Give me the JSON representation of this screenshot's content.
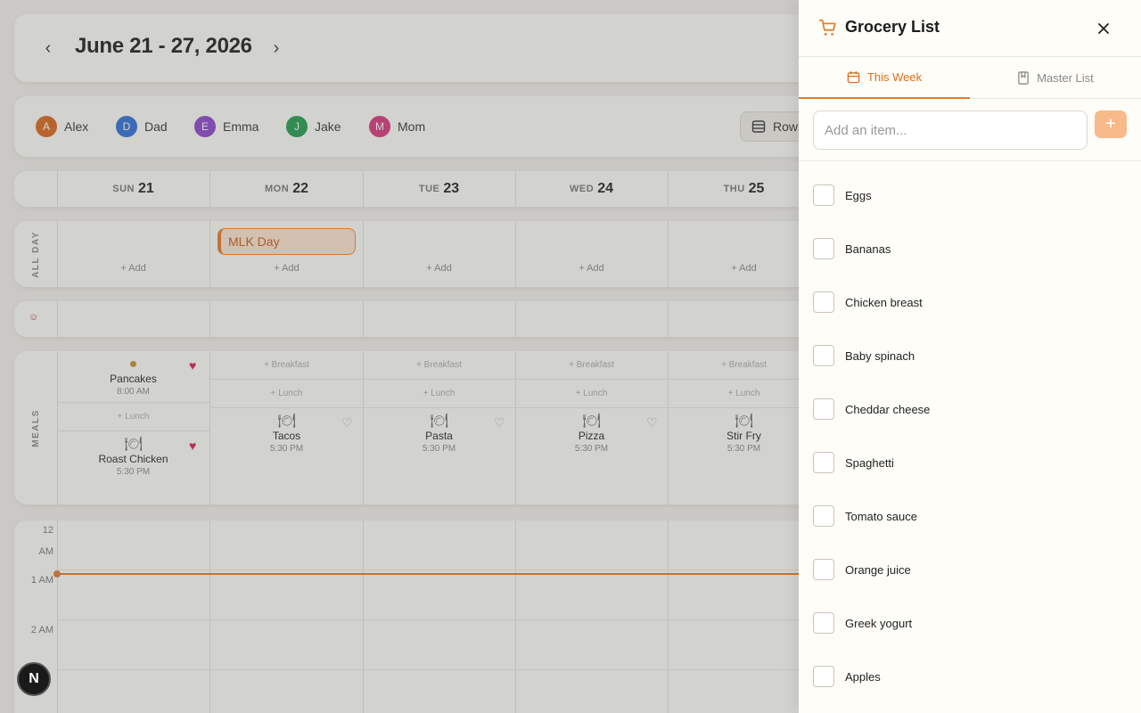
{
  "calendar": {
    "week_title": "June 21 - 27, 2026",
    "members": [
      {
        "initial": "A",
        "name": "Alex",
        "color": "#d9651b"
      },
      {
        "initial": "D",
        "name": "Dad",
        "color": "#2f6fd6"
      },
      {
        "initial": "E",
        "name": "Emma",
        "color": "#8a44c9"
      },
      {
        "initial": "J",
        "name": "Jake",
        "color": "#1f9a4a"
      },
      {
        "initial": "M",
        "name": "Mom",
        "color": "#d6357a"
      }
    ],
    "view_toggle": "Rows",
    "days": [
      {
        "dow": "SUN",
        "num": "21"
      },
      {
        "dow": "MON",
        "num": "22"
      },
      {
        "dow": "TUE",
        "num": "23"
      },
      {
        "dow": "WED",
        "num": "24"
      },
      {
        "dow": "THU",
        "num": "25"
      }
    ],
    "all_day_label": "ALL DAY",
    "add_label": "+ Add",
    "event": "MLK Day",
    "meals_label": "MEALS",
    "breakfast_add": "+ Breakfast",
    "lunch_add": "+ Lunch",
    "sun_breakfast": {
      "name": "Pancakes",
      "time": "8:00 AM"
    },
    "sun_dinner": {
      "name": "Roast Chicken",
      "time": "5:30 PM"
    },
    "dinners": [
      {
        "name": "Tacos",
        "time": "5:30 PM"
      },
      {
        "name": "Pasta",
        "time": "5:30 PM"
      },
      {
        "name": "Pizza",
        "time": "5:30 PM"
      },
      {
        "name": "Stir Fry",
        "time": "5:30 PM"
      }
    ],
    "hours": [
      "12",
      "AM",
      "1 AM",
      "2 AM"
    ],
    "accent": "#e47a22",
    "badge": "N"
  },
  "grocery": {
    "title": "Grocery List",
    "tabs": {
      "this_week": "This Week",
      "master": "Master List"
    },
    "placeholder": "Add an item...",
    "add_symbol": "+",
    "items": [
      "Eggs",
      "Bananas",
      "Chicken breast",
      "Baby spinach",
      "Cheddar cheese",
      "Spaghetti",
      "Tomato sauce",
      "Orange juice",
      "Greek yogurt",
      "Apples"
    ]
  }
}
